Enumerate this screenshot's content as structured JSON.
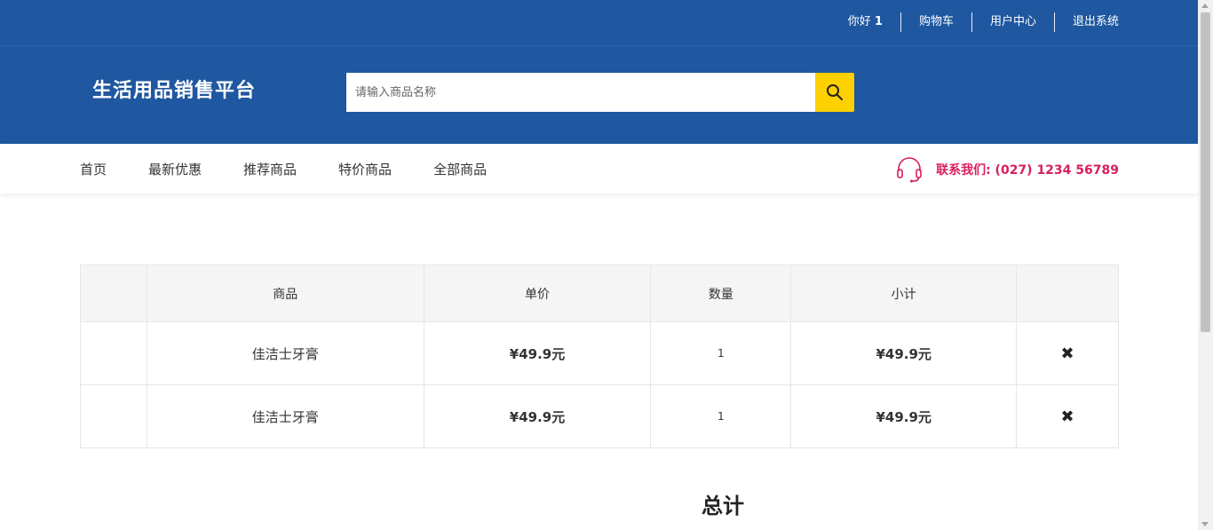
{
  "topbar": {
    "hello_label": "你好",
    "user": "1",
    "cart": "购物车",
    "user_center": "用户中心",
    "logout": "退出系统"
  },
  "header": {
    "logo": "生活用品销售平台",
    "search_placeholder": "请输入商品名称",
    "search_icon": "search-icon"
  },
  "nav": {
    "items": [
      "首页",
      "最新优惠",
      "推荐商品",
      "特价商品",
      "全部商品"
    ],
    "contact_label": "联系我们: (027) 1234 56789",
    "contact_icon": "headset-icon"
  },
  "cart": {
    "headers": [
      "",
      "商品",
      "单价",
      "数量",
      "小计",
      ""
    ],
    "rows": [
      {
        "name": "佳洁士牙膏",
        "price": "¥49.9元",
        "qty": "1",
        "subtotal": "¥49.9元",
        "remove": "✖"
      },
      {
        "name": "佳洁士牙膏",
        "price": "¥49.9元",
        "qty": "1",
        "subtotal": "¥49.9元",
        "remove": "✖"
      }
    ]
  },
  "total_label": "总计",
  "colors": {
    "brand_blue": "#1f57a0",
    "search_button": "#fdd000",
    "contact_red": "#d8205a"
  }
}
